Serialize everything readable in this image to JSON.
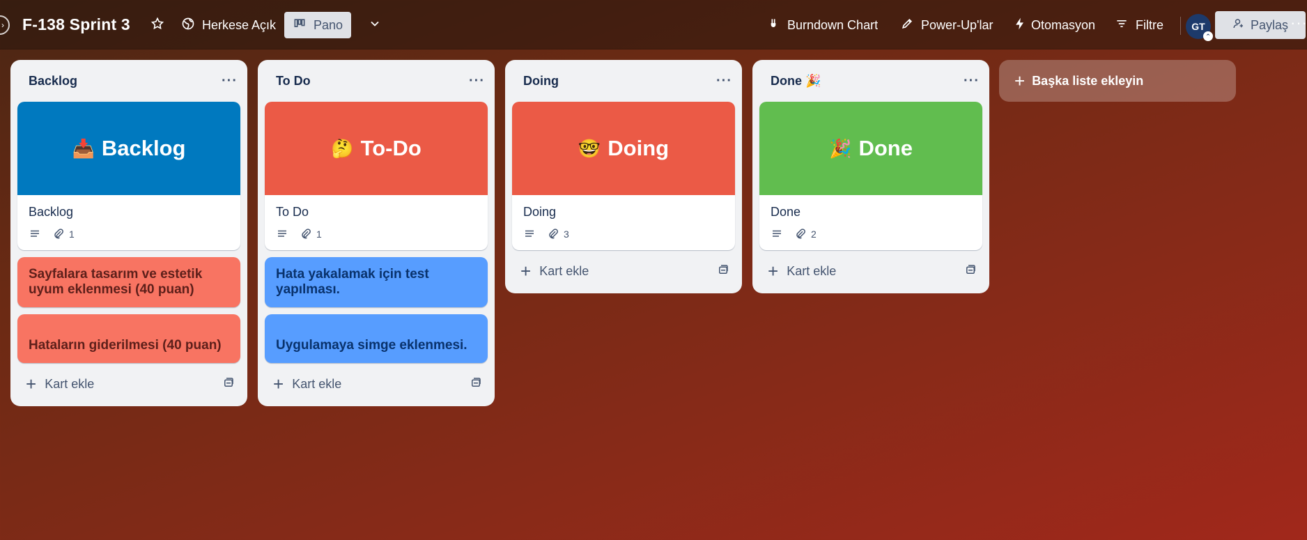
{
  "header": {
    "board_title": "F-138 Sprint 3",
    "visibility_label": "Herkese Açık",
    "view_label": "Pano",
    "burndown_label": "Burndown Chart",
    "powerups_label": "Power-Up'lar",
    "automation_label": "Otomasyon",
    "filter_label": "Filtre",
    "avatar_initials": "GT",
    "share_label": "Paylaş",
    "more_label": "···"
  },
  "lists": [
    {
      "title": "Backlog",
      "cover_card": {
        "cover_color": "#0079bf",
        "cover_emoji": "📥",
        "cover_text": "Backlog",
        "title": "Backlog",
        "attachments": "1"
      },
      "cards": [
        {
          "text": "Sayfalara tasarım ve estetik uyum eklenmesi (40 puan)",
          "color": "red"
        },
        {
          "text": "Hataların giderilmesi (40 puan)",
          "color": "red"
        }
      ],
      "add_card_label": "Kart ekle"
    },
    {
      "title": "To Do",
      "cover_card": {
        "cover_color": "#eb5a46",
        "cover_emoji": "🤔",
        "cover_text": "To-Do",
        "title": "To Do",
        "attachments": "1"
      },
      "cards": [
        {
          "text": "Hata yakalamak için test yapılması.",
          "color": "blue"
        },
        {
          "text": "Uygulamaya simge eklenmesi.",
          "color": "blue"
        }
      ],
      "add_card_label": "Kart ekle"
    },
    {
      "title": "Doing",
      "cover_card": {
        "cover_color": "#eb5a46",
        "cover_emoji": "🤓",
        "cover_text": "Doing",
        "title": "Doing",
        "attachments": "3"
      },
      "cards": [],
      "add_card_label": "Kart ekle"
    },
    {
      "title": "Done 🎉",
      "cover_card": {
        "cover_color": "#61bd4f",
        "cover_emoji": "🎉",
        "cover_text": "Done",
        "title": "Done",
        "attachments": "2"
      },
      "cards": [],
      "add_card_label": "Kart ekle"
    }
  ],
  "add_list_label": "Başka liste ekleyin",
  "list_menu_label": "···"
}
